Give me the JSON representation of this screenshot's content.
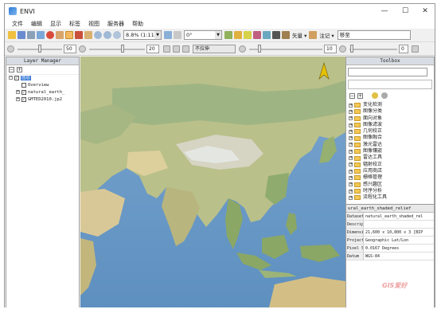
{
  "window": {
    "title": "ENVI",
    "minimize": "—",
    "maximize": "☐",
    "close": "✕"
  },
  "menu": [
    "文件",
    "编辑",
    "显示",
    "标签",
    "视图",
    "服务器",
    "帮助"
  ],
  "toolbar1": {
    "zoom_value": "8.8% (1:11.4",
    "rotation_value": "0°",
    "vector_label": "矢量",
    "annotation_label": "注记",
    "search_value": "移至"
  },
  "toolbar2": {
    "brightness": "50",
    "contrast": "20",
    "stretch_label": "不拉伸",
    "sharpen": "10",
    "transparency": "0"
  },
  "layer_manager": {
    "title": "Layer Manager",
    "tree": [
      {
        "label": "图层",
        "level": 0,
        "expander": "−",
        "check": "✓",
        "selected": true
      },
      {
        "label": "Overview",
        "level": 1,
        "expander": "",
        "check": ""
      },
      {
        "label": "natural_earth_",
        "level": 1,
        "expander": "+",
        "check": "✓"
      },
      {
        "label": "GMTED2010.jp2",
        "level": 1,
        "expander": "+",
        "check": "✓"
      }
    ]
  },
  "toolbox": {
    "title": "Toolbox",
    "items": [
      "变化检测",
      "图像分类",
      "面向对象",
      "图像滤波",
      "几何校正",
      "图像融合",
      "激光雷达",
      "图像镶嵌",
      "雷达工具",
      "辐射校正",
      "应用商店",
      "栅格管理",
      "感兴趣区",
      "时序分析",
      "流程化工具"
    ]
  },
  "metadata": {
    "header": "ural_earth_shaded_relief",
    "rows": [
      {
        "key": "Dataset",
        "value": "natural_earth_shaded_rel"
      },
      {
        "key": "Descript",
        "value": ""
      },
      {
        "key": "Dimensio",
        "value": "21,600 x 10,800 x 3 [BIP"
      },
      {
        "key": "Projecti",
        "value": "Geographic Lat/Lon"
      },
      {
        "key": "Pixel Si",
        "value": "0.0167 Degrees"
      },
      {
        "key": "Datum",
        "value": "WGS-84"
      }
    ]
  },
  "watermark": "GIS爱好",
  "colors": {
    "ocean": "#6e9ec9",
    "land": "#c9c896",
    "forest": "#8fb07a",
    "snow": "#e8ebe8",
    "north_arrow": "#e6c200"
  }
}
